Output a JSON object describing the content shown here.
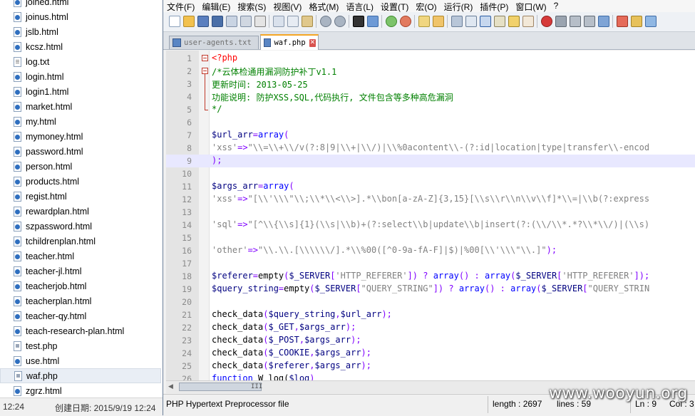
{
  "explorer": {
    "files": [
      {
        "name": "joined.html",
        "type": "html"
      },
      {
        "name": "joinus.html",
        "type": "html"
      },
      {
        "name": "jslb.html",
        "type": "html"
      },
      {
        "name": "kcsz.html",
        "type": "html"
      },
      {
        "name": "log.txt",
        "type": "txt"
      },
      {
        "name": "login.html",
        "type": "html"
      },
      {
        "name": "login1.html",
        "type": "html"
      },
      {
        "name": "market.html",
        "type": "html"
      },
      {
        "name": "my.html",
        "type": "html"
      },
      {
        "name": "mymoney.html",
        "type": "html"
      },
      {
        "name": "password.html",
        "type": "html"
      },
      {
        "name": "person.html",
        "type": "html"
      },
      {
        "name": "products.html",
        "type": "html"
      },
      {
        "name": "regist.html",
        "type": "html"
      },
      {
        "name": "rewardplan.html",
        "type": "html"
      },
      {
        "name": "szpassword.html",
        "type": "html"
      },
      {
        "name": "tchildrenplan.html",
        "type": "html"
      },
      {
        "name": "teacher.html",
        "type": "html"
      },
      {
        "name": "teacher-jl.html",
        "type": "html"
      },
      {
        "name": "teacherjob.html",
        "type": "html"
      },
      {
        "name": "teacherplan.html",
        "type": "html"
      },
      {
        "name": "teacher-qy.html",
        "type": "html"
      },
      {
        "name": "teach-research-plan.html",
        "type": "html"
      },
      {
        "name": "test.php",
        "type": "php"
      },
      {
        "name": "use.html",
        "type": "html"
      },
      {
        "name": "waf.php",
        "type": "php",
        "selected": true
      },
      {
        "name": "zgrz.html",
        "type": "html"
      }
    ],
    "status_time": "12:24",
    "status_created": "创建日期: 2015/9/19 12:24"
  },
  "menu": [
    "文件(F)",
    "编辑(E)",
    "搜索(S)",
    "视图(V)",
    "格式(M)",
    "语言(L)",
    "设置(T)",
    "宏(O)",
    "运行(R)",
    "插件(P)",
    "窗口(W)",
    "?"
  ],
  "tabs": [
    {
      "label": "user-agents.txt",
      "active": false
    },
    {
      "label": "waf.php",
      "active": true
    }
  ],
  "code": {
    "current_line": 9,
    "lines": [
      {
        "n": "1",
        "t": [
          [
            "php",
            "<?php"
          ]
        ]
      },
      {
        "n": "2",
        "t": [
          [
            "cmt",
            "/*云体检通用漏洞防护补丁v1.1"
          ]
        ]
      },
      {
        "n": "3",
        "t": [
          [
            "cmt",
            "更新时间: 2013-05-25"
          ]
        ]
      },
      {
        "n": "4",
        "t": [
          [
            "cmt",
            "功能说明: 防护XSS,SQL,代码执行, 文件包含等多种高危漏洞"
          ]
        ]
      },
      {
        "n": "5",
        "t": [
          [
            "cmt",
            "*/"
          ]
        ]
      },
      {
        "n": "6",
        "t": []
      },
      {
        "n": "7",
        "t": [
          [
            "var",
            "$url_arr"
          ],
          [
            "op",
            "="
          ],
          [
            "kw",
            "array"
          ],
          [
            "op",
            "("
          ]
        ]
      },
      {
        "n": "8",
        "t": [
          [
            "str",
            "'xss'"
          ],
          [
            "op",
            "=>"
          ],
          [
            "str",
            "\"\\\\=\\\\+\\\\/v(?:8|9|\\\\+|\\\\/)|\\\\%0acontent\\\\-(?:id|location|type|transfer\\\\-encod"
          ]
        ]
      },
      {
        "n": "9",
        "t": [
          [
            "op",
            ");"
          ]
        ]
      },
      {
        "n": "10",
        "t": []
      },
      {
        "n": "11",
        "t": [
          [
            "var",
            "$args_arr"
          ],
          [
            "op",
            "="
          ],
          [
            "kw",
            "array"
          ],
          [
            "op",
            "("
          ]
        ]
      },
      {
        "n": "12",
        "t": [
          [
            "str",
            "'xss'"
          ],
          [
            "op",
            "=>"
          ],
          [
            "str",
            "\"[\\\\'\\\\\\\"\\\\;\\\\*\\\\<\\\\>].*\\\\bon[a-zA-Z]{3,15}[\\\\s\\\\r\\\\n\\\\v\\\\f]*\\\\=|\\\\b(?:express"
          ]
        ]
      },
      {
        "n": "13",
        "t": []
      },
      {
        "n": "14",
        "t": [
          [
            "str",
            "'sql'"
          ],
          [
            "op",
            "=>"
          ],
          [
            "str",
            "\"[^\\\\{\\\\s]{1}(\\\\s|\\\\b)+(?:select\\\\b|update\\\\b|insert(?:(\\\\/\\\\*.*?\\\\*\\\\/)|(\\\\s)"
          ]
        ]
      },
      {
        "n": "15",
        "t": []
      },
      {
        "n": "16",
        "t": [
          [
            "str",
            "'other'"
          ],
          [
            "op",
            "=>"
          ],
          [
            "str",
            "\"\\\\.\\\\.[\\\\\\\\\\\\/].*\\\\%00([^0-9a-fA-F]|$)|%00[\\\\'\\\\\\\"\\\\.]\""
          ],
          [
            "op",
            ");"
          ]
        ]
      },
      {
        "n": "17",
        "t": []
      },
      {
        "n": "18",
        "t": [
          [
            "var",
            "$referer"
          ],
          [
            "op",
            "="
          ],
          [
            "def",
            "empty"
          ],
          [
            "op",
            "("
          ],
          [
            "var",
            "$_SERVER"
          ],
          [
            "op",
            "["
          ],
          [
            "str",
            "'HTTP_REFERER'"
          ],
          [
            "op",
            "])"
          ],
          [
            "def",
            " "
          ],
          [
            "op",
            "?"
          ],
          [
            "def",
            " "
          ],
          [
            "kw",
            "array"
          ],
          [
            "op",
            "()"
          ],
          [
            "def",
            " "
          ],
          [
            "op",
            ":"
          ],
          [
            "def",
            " "
          ],
          [
            "kw",
            "array"
          ],
          [
            "op",
            "("
          ],
          [
            "var",
            "$_SERVER"
          ],
          [
            "op",
            "["
          ],
          [
            "str",
            "'HTTP_REFERER'"
          ],
          [
            "op",
            "]);"
          ]
        ]
      },
      {
        "n": "19",
        "t": [
          [
            "var",
            "$query_string"
          ],
          [
            "op",
            "="
          ],
          [
            "def",
            "empty"
          ],
          [
            "op",
            "("
          ],
          [
            "var",
            "$_SERVER"
          ],
          [
            "op",
            "["
          ],
          [
            "str",
            "\"QUERY_STRING\""
          ],
          [
            "op",
            "])"
          ],
          [
            "def",
            " "
          ],
          [
            "op",
            "?"
          ],
          [
            "def",
            " "
          ],
          [
            "kw",
            "array"
          ],
          [
            "op",
            "()"
          ],
          [
            "def",
            " "
          ],
          [
            "op",
            ":"
          ],
          [
            "def",
            " "
          ],
          [
            "kw",
            "array"
          ],
          [
            "op",
            "("
          ],
          [
            "var",
            "$_SERVER"
          ],
          [
            "op",
            "["
          ],
          [
            "str",
            "\"QUERY_STRIN"
          ]
        ]
      },
      {
        "n": "20",
        "t": []
      },
      {
        "n": "21",
        "t": [
          [
            "def",
            "check_data"
          ],
          [
            "op",
            "("
          ],
          [
            "var",
            "$query_string"
          ],
          [
            "op",
            ","
          ],
          [
            "var",
            "$url_arr"
          ],
          [
            "op",
            ");"
          ]
        ]
      },
      {
        "n": "22",
        "t": [
          [
            "def",
            "check_data"
          ],
          [
            "op",
            "("
          ],
          [
            "var",
            "$_GET"
          ],
          [
            "op",
            ","
          ],
          [
            "var",
            "$args_arr"
          ],
          [
            "op",
            ");"
          ]
        ]
      },
      {
        "n": "23",
        "t": [
          [
            "def",
            "check_data"
          ],
          [
            "op",
            "("
          ],
          [
            "var",
            "$_POST"
          ],
          [
            "op",
            ","
          ],
          [
            "var",
            "$args_arr"
          ],
          [
            "op",
            ");"
          ]
        ]
      },
      {
        "n": "24",
        "t": [
          [
            "def",
            "check_data"
          ],
          [
            "op",
            "("
          ],
          [
            "var",
            "$_COOKIE"
          ],
          [
            "op",
            ","
          ],
          [
            "var",
            "$args_arr"
          ],
          [
            "op",
            ");"
          ]
        ]
      },
      {
        "n": "25",
        "t": [
          [
            "def",
            "check_data"
          ],
          [
            "op",
            "("
          ],
          [
            "var",
            "$referer"
          ],
          [
            "op",
            ","
          ],
          [
            "var",
            "$args_arr"
          ],
          [
            "op",
            ");"
          ]
        ]
      },
      {
        "n": "26",
        "t": [
          [
            "kw",
            "function"
          ],
          [
            "def",
            " W_log("
          ],
          [
            "var",
            "$log"
          ],
          [
            "op",
            ")"
          ]
        ]
      }
    ]
  },
  "scrollbar": {
    "grip": "III"
  },
  "status": {
    "file_type": "PHP Hypertext Preprocessor file",
    "length": "length : 2697",
    "lines": "lines : 59",
    "ln": "Ln : 9",
    "col": "Col : 3"
  },
  "watermark": "www.wooyun.org",
  "colors": {
    "comment": "#008000",
    "php_tag": "#ff0000",
    "variable": "#000080",
    "string": "#808080",
    "operator": "#8000ff",
    "keyword": "#0000ff",
    "current_line": "#e8e8ff",
    "active_tab_accent": "#f5a623"
  }
}
